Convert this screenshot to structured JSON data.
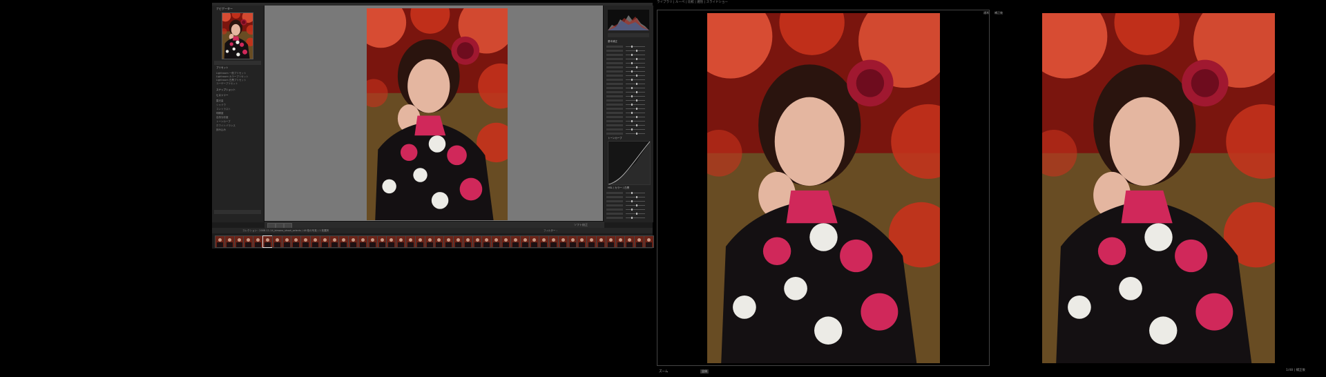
{
  "photo_colors": {
    "leaves": "#c8321c",
    "leaves_dark": "#7a150e",
    "skin": "#e4b6a0",
    "hair": "#2a140e",
    "dress": "#141012",
    "flower_pink": "#d0285a",
    "flower_white": "#ecebe6",
    "grass": "#5a7a34",
    "bokeh": "#e8563a"
  },
  "monitor1": {
    "navigator": {
      "title": "ナビゲーター",
      "preset_section": "プリセット",
      "presets": [
        "Lightroom 一般プリセット",
        "Lightroom カラープリセット",
        "Lightroom 白黒プリセット",
        "ユーザープリセット"
      ],
      "snapshots": "スナップショット",
      "history_title": "ヒストリー",
      "history": [
        "露光量",
        "シャドウ",
        "コントラスト",
        "明瞭度",
        "自然な彩度",
        "トーンカーブ",
        "ホワイトバランス",
        "読み込み"
      ]
    },
    "toolbar": {
      "label": "ソフト校正"
    },
    "filmstrip": {
      "path": "コレクション : 2008-11-14_kimono_shoot_selects / 48 枚の写真 / 1 枚選択",
      "count": 46,
      "selected_index": 5,
      "filter": "フィルター :"
    },
    "right_panel": {
      "histogram": "ヒストグラム",
      "basic": "基本補正",
      "tone_curve": "トーンカーブ",
      "hsl": "HSL / カラー / 白黒"
    }
  },
  "monitor2": {
    "menu": [
      "ライブラリ",
      "ルーペ",
      "比較",
      "選別",
      "スライドショー"
    ],
    "tag": "通常",
    "zoom_label": "ズーム",
    "zoom_value": "全体"
  },
  "monitor3": {
    "tag": "補正後",
    "status": "1/48 | 補正後"
  }
}
